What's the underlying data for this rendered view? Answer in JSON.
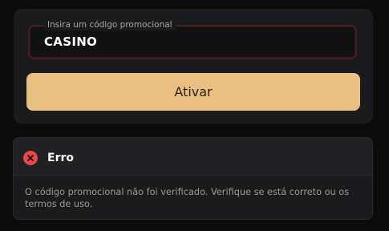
{
  "promo": {
    "label": "Insira um código promocional",
    "value": "CASINO",
    "button_label": "Ativar"
  },
  "error": {
    "icon": "close-icon",
    "title": "Erro",
    "message": "O código promocional não foi verificado. Verifique se está correto ou os termos de uso."
  },
  "colors": {
    "accent": "#eabf82",
    "error": "#e5484d",
    "card": "#1b1b1d"
  }
}
